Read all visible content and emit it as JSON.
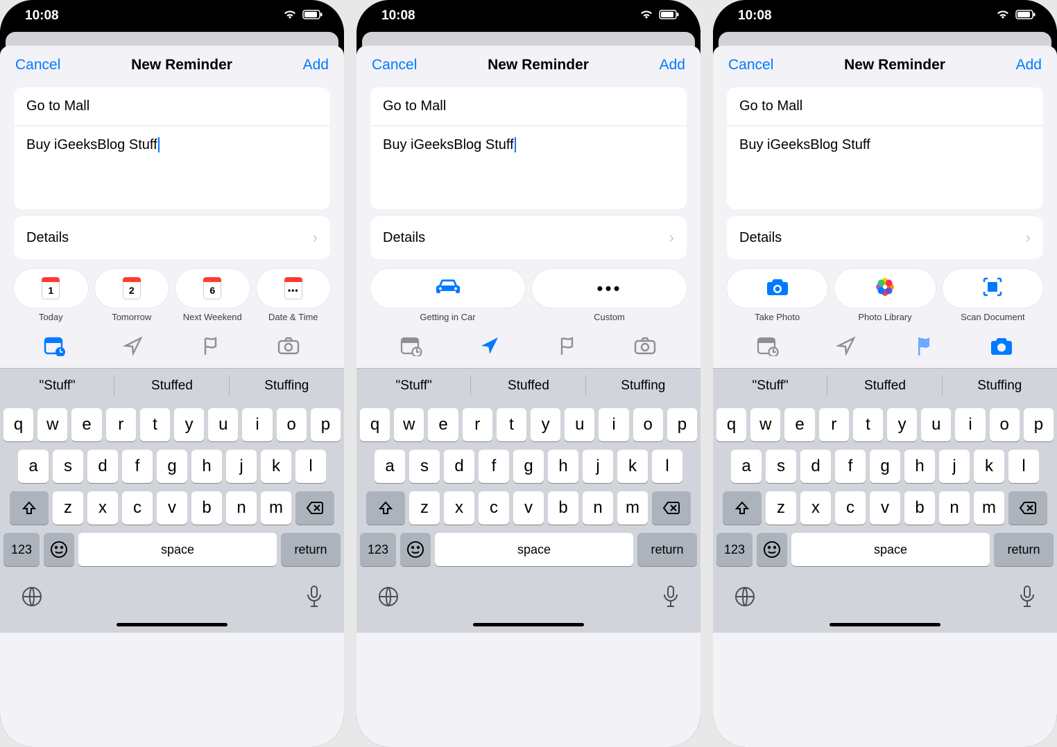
{
  "status": {
    "time": "10:08"
  },
  "nav": {
    "cancel": "Cancel",
    "title": "New Reminder",
    "add": "Add"
  },
  "reminder": {
    "title": "Go to Mall",
    "notes": "Buy iGeeksBlog Stuff"
  },
  "details": {
    "label": "Details"
  },
  "screens": [
    {
      "quick": [
        {
          "label": "Today",
          "day": "1"
        },
        {
          "label": "Tomorrow",
          "day": "2"
        },
        {
          "label": "Next Weekend",
          "day": "6"
        },
        {
          "label": "Date & Time",
          "day": ""
        }
      ],
      "activeTab": 0,
      "showCursor": true
    },
    {
      "quick": [
        {
          "label": "Getting in Car"
        },
        {
          "label": "Custom"
        }
      ],
      "activeTab": 1,
      "showCursor": true
    },
    {
      "quick": [
        {
          "label": "Take Photo"
        },
        {
          "label": "Photo Library"
        },
        {
          "label": "Scan Document"
        }
      ],
      "activeTab": 3,
      "flagLight": true,
      "showCursor": false
    }
  ],
  "suggestions": [
    "\"Stuff\"",
    "Stuffed",
    "Stuffing"
  ],
  "keyboard": {
    "row1": [
      "q",
      "w",
      "e",
      "r",
      "t",
      "y",
      "u",
      "i",
      "o",
      "p"
    ],
    "row2": [
      "a",
      "s",
      "d",
      "f",
      "g",
      "h",
      "j",
      "k",
      "l"
    ],
    "row3": [
      "z",
      "x",
      "c",
      "v",
      "b",
      "n",
      "m"
    ],
    "num": "123",
    "space": "space",
    "return": "return"
  }
}
